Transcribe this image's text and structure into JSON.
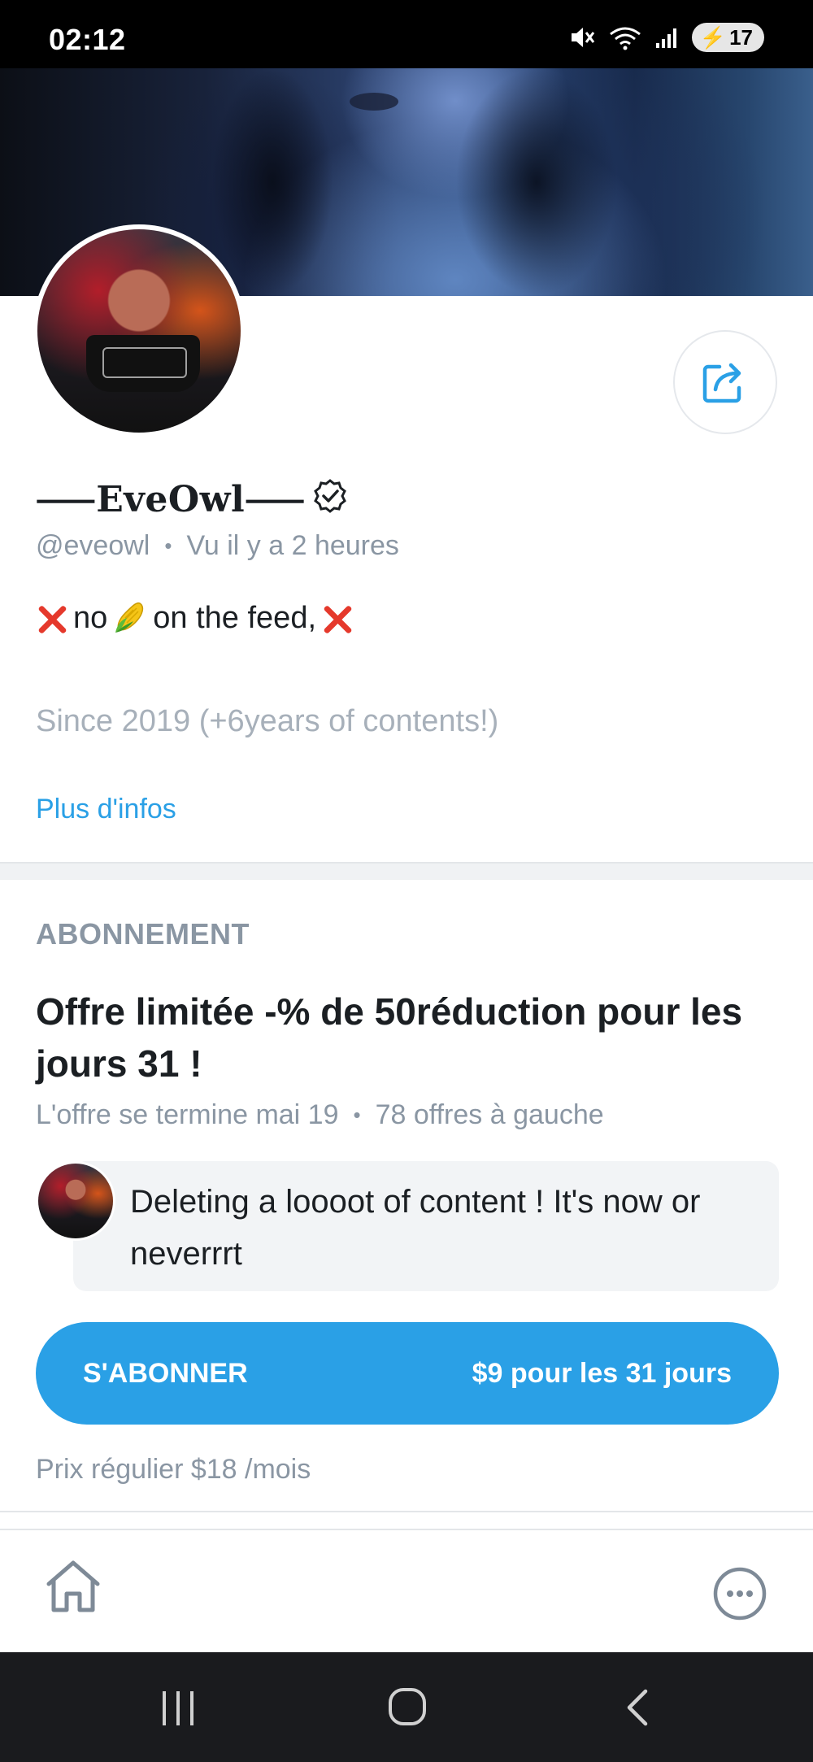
{
  "status_bar": {
    "time": "02:12",
    "battery": "17"
  },
  "profile": {
    "display_name": "⸺EveOwl⸺",
    "handle": "@eveowl",
    "last_seen": "Vu  il y a 2 heures",
    "bio_line1_text_a": "no",
    "bio_line1_text_b": "on the feed,",
    "bio_line2": "Since 2019 (+6years of contents!)",
    "more_info": "Plus d'infos"
  },
  "subscription": {
    "section_title": "ABONNEMENT",
    "offer_title": "Offre limitée -% de 50réduction pour les jours 31 !",
    "offer_ends": "L'offre se termine mai 19",
    "offers_left": "78 offres à gauche",
    "message": "Deleting a loooot of content ! It's now or neverrrt",
    "button_label": "S'ABONNER",
    "button_price": "$9 pour les 31 jours",
    "regular_price": "Prix régulier $18 /mois"
  },
  "colors": {
    "accent": "#2aa0e6",
    "muted": "#8a96a3",
    "text": "#1b1f23"
  },
  "icons": [
    "mute-icon",
    "wifi-icon",
    "signal-icon",
    "battery-icon",
    "share-icon",
    "verified-icon",
    "home-icon",
    "more-icon",
    "recent-apps-icon",
    "android-home-icon",
    "back-icon"
  ]
}
